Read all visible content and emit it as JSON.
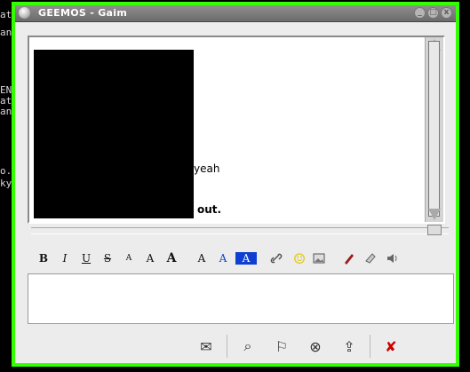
{
  "background_terminal": {
    "lines": [
      "at",
      "an",
      "EN",
      "at",
      "an",
      "o.",
      "ky"
    ]
  },
  "window": {
    "title": "GEEMOS - Gaim",
    "title_buttons": [
      "_",
      "□",
      "x"
    ]
  },
  "conversation": {
    "messages": [
      {
        "text": "yeah",
        "bold": false
      },
      {
        "text": "out.",
        "bold": true
      }
    ]
  },
  "format_toolbar": {
    "bold": "B",
    "italic": "I",
    "underline": "U",
    "strike": "S",
    "smaller": "A",
    "normal": "A",
    "larger": "A",
    "face": "A",
    "fg_color": "A",
    "bg_color": "A",
    "link_icon": "link-icon",
    "smiley_icon": "smiley-icon",
    "image_icon": "image-icon",
    "pen_icon": "pen-icon",
    "clear_icon": "clear-formatting-icon",
    "sound_icon": "sound-icon"
  },
  "bottom_actions": [
    {
      "name": "send-file",
      "icon": "file-transfer-icon"
    },
    {
      "name": "info",
      "icon": "info-icon"
    },
    {
      "name": "warn",
      "icon": "warn-icon"
    },
    {
      "name": "block",
      "icon": "block-icon"
    },
    {
      "name": "add",
      "icon": "add-icon"
    },
    {
      "name": "send",
      "icon": "send-icon"
    }
  ],
  "colors": {
    "window_border": "#33ff00",
    "window_bg": "#ececec",
    "titlebar": "#7d7d7d",
    "accent_blue": "#0f3fd0"
  }
}
